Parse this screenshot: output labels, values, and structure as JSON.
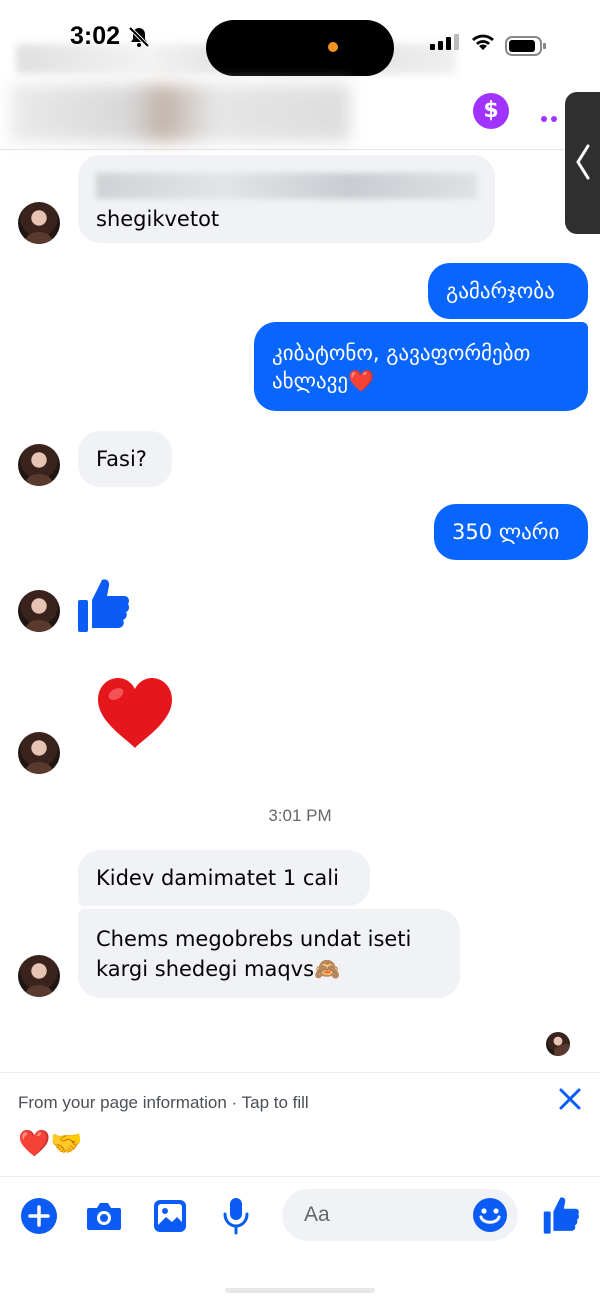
{
  "status_bar": {
    "time": "3:02",
    "icons": [
      "bell-off-icon",
      "cellular-signal-icon",
      "wifi-icon",
      "battery-icon"
    ]
  },
  "header": {
    "contact_name": "",
    "icons": [
      "payment-icon",
      "more-icon"
    ],
    "payment_symbol": "$",
    "accent_color": "#a033ff"
  },
  "messages": {
    "m1_text": "shegikvetot",
    "m2_text": "გამარჯობა",
    "m3_text": "კიბატონო, გავაფორმებთ ახლავე❤️",
    "m4_text": "Fasi?",
    "m5_text": "350 ლარი",
    "m6_emoji": "thumbs-up-icon",
    "m7_emoji": "❤️",
    "timestamp": "3:01 PM",
    "m8_text": "Kidev damimatet 1 cali",
    "m9_text": "Chems megobrebs undat iseti kargi shedegi maqvs🙈"
  },
  "quick_fill": {
    "text": "From your page information · Tap to fill",
    "emojis": "❤️🤝"
  },
  "composer": {
    "placeholder": "Aa",
    "icons": [
      "add-icon",
      "camera-icon",
      "gallery-icon",
      "microphone-icon",
      "emoji-icon",
      "like-icon"
    ]
  },
  "colors": {
    "outgoing_bubble": "#0866ff",
    "incoming_bubble": "#f0f2f5",
    "icon_blue": "#0a5cf5"
  }
}
